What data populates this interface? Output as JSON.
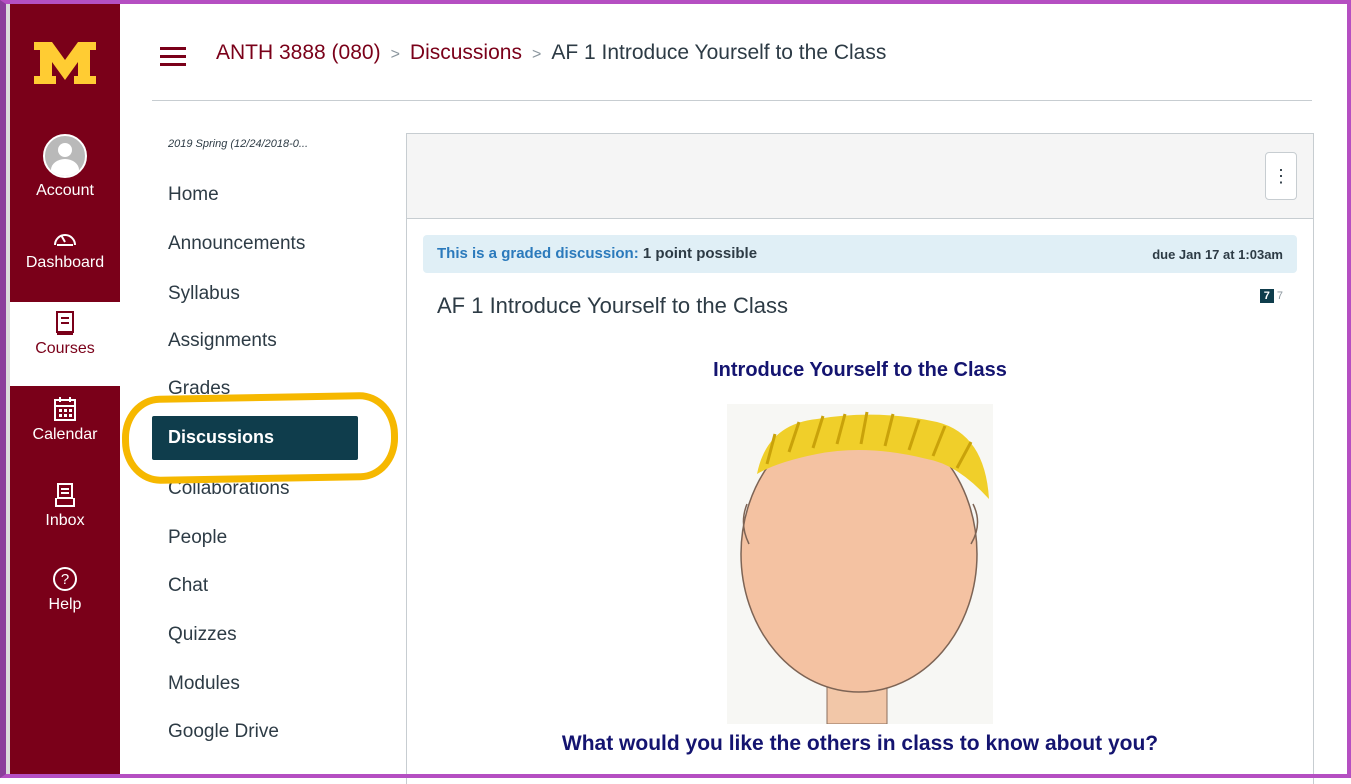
{
  "global_nav": {
    "items": [
      {
        "label": "Account",
        "icon": "account-avatar-icon"
      },
      {
        "label": "Dashboard",
        "icon": "dashboard-gauge-icon"
      },
      {
        "label": "Courses",
        "icon": "courses-book-icon",
        "active": true
      },
      {
        "label": "Calendar",
        "icon": "calendar-icon"
      },
      {
        "label": "Inbox",
        "icon": "inbox-icon"
      },
      {
        "label": "Help",
        "icon": "help-icon"
      }
    ],
    "colors": {
      "brand": "#7a0019",
      "gold": "#ffcc33"
    }
  },
  "breadcrumb": {
    "course": "ANTH 3888 (080)",
    "section": "Discussions",
    "current": "AF 1 Introduce Yourself to the Class"
  },
  "course_nav": {
    "term": "2019 Spring (12/24/2018-0...",
    "items": [
      "Home",
      "Announcements",
      "Syllabus",
      "Assignments",
      "Grades",
      "Discussions",
      "Collaborations",
      "People",
      "Chat",
      "Quizzes",
      "Modules",
      "Google Drive"
    ],
    "active": "Discussions",
    "active_color": "#0f3d4c",
    "highlight_color": "#f6b800"
  },
  "discussion": {
    "graded_label": "This is a graded discussion:",
    "points": "1 point possible",
    "due": "due Jan 17 at 1:03am",
    "title": "AF 1 Introduce Yourself to the Class",
    "unread_count": "7",
    "total_count": "7",
    "heading": "Introduce Yourself to the Class",
    "question": "What would you like the others in class to know about you?",
    "kebab": "⋮"
  }
}
